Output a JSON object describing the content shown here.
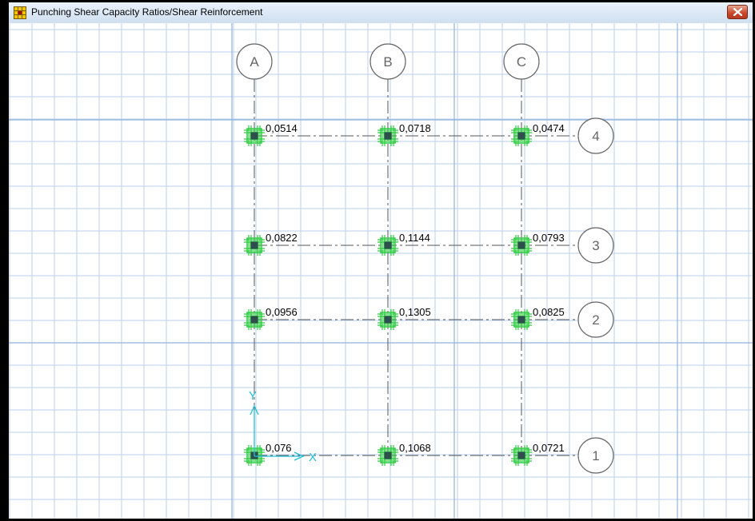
{
  "window": {
    "title": "Punching Shear Capacity Ratios/Shear Reinforcement",
    "title_icon": "grid-app-icon",
    "close_icon": "close-icon",
    "close_color": "#c9452a"
  },
  "plan": {
    "colors": {
      "grid_fine": "#b9d2ee",
      "grid_major": "#8fb2dc",
      "gridline": "#555555",
      "column": "#2ecc40",
      "axis": "#22c1d6"
    },
    "axes": {
      "x_label": "X",
      "y_label": "Y"
    },
    "grid_columns": [
      {
        "label": "A"
      },
      {
        "label": "B"
      },
      {
        "label": "C"
      }
    ],
    "grid_rows": [
      {
        "label": "4"
      },
      {
        "label": "3"
      },
      {
        "label": "2"
      },
      {
        "label": "1"
      }
    ],
    "ratios": [
      {
        "col": "A",
        "row": "4",
        "value": "0,0514"
      },
      {
        "col": "B",
        "row": "4",
        "value": "0,0718"
      },
      {
        "col": "C",
        "row": "4",
        "value": "0,0474"
      },
      {
        "col": "A",
        "row": "3",
        "value": "0,0822"
      },
      {
        "col": "B",
        "row": "3",
        "value": "0,1144"
      },
      {
        "col": "C",
        "row": "3",
        "value": "0,0793"
      },
      {
        "col": "A",
        "row": "2",
        "value": "0,0956"
      },
      {
        "col": "B",
        "row": "2",
        "value": "0,1305"
      },
      {
        "col": "C",
        "row": "2",
        "value": "0,0825"
      },
      {
        "col": "A",
        "row": "1",
        "value": "0,076"
      },
      {
        "col": "B",
        "row": "1",
        "value": "0,1068"
      },
      {
        "col": "C",
        "row": "1",
        "value": "0,0721"
      }
    ]
  }
}
